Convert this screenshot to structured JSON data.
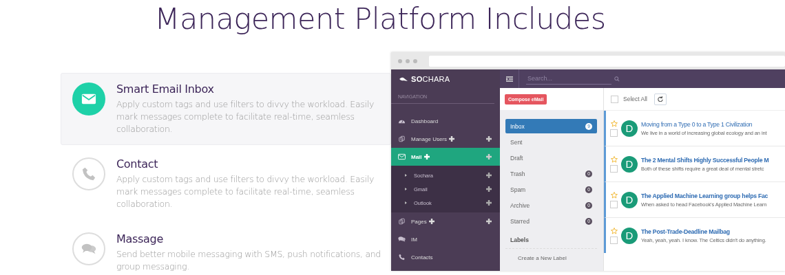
{
  "heading": "Management Platform Includes",
  "features": [
    {
      "kind": "mail",
      "title": "Smart Email Inbox",
      "description": "Apply custom tags and use filters to divvy the workload. Easily mark messages complete to facilitate real-time, seamless collaboration.",
      "selected": true
    },
    {
      "kind": "phone",
      "title": "Contact",
      "description": "Apply custom tags and use filters to divvy the workload. Easily mark messages complete to facilitate real-time, seamless collaboration.",
      "selected": false
    },
    {
      "kind": "chat",
      "title": "Massage",
      "description": "Send better mobile messaging with SMS, push notifications, and group messaging.",
      "selected": false
    }
  ],
  "app": {
    "logo": "**SO**CHARA",
    "navigation_label": "NAVIGATION",
    "nav_items": [
      {
        "kind": "dashboard",
        "label": "Dashboard",
        "has_add": false,
        "selected": false
      },
      {
        "kind": "users",
        "label": "Manage Users",
        "has_add": true,
        "selected": false
      },
      {
        "kind": "mail",
        "label": "Mail",
        "has_add": true,
        "selected": true,
        "children": [
          {
            "label": "Sochara"
          },
          {
            "label": "Gmail"
          },
          {
            "label": "Outlook"
          }
        ]
      },
      {
        "kind": "users",
        "label": "Pages",
        "has_add": true,
        "selected": false
      },
      {
        "kind": "chat",
        "label": "IM",
        "has_add": false,
        "selected": false
      },
      {
        "kind": "phone",
        "label": "Contacts",
        "has_add": false,
        "selected": false
      }
    ],
    "search": {
      "placeholder": "Search..."
    },
    "compose_button": "Compose eMail",
    "folders": [
      {
        "label": "Inbox",
        "count": "9",
        "selected": true
      },
      {
        "label": "Sent",
        "selected": false
      },
      {
        "label": "Draft",
        "selected": false
      },
      {
        "label": "Trash",
        "count": "0",
        "selected": false
      },
      {
        "label": "Spam",
        "count": "0",
        "selected": false
      },
      {
        "label": "Archive",
        "count": "0",
        "selected": false
      },
      {
        "label": "Starred",
        "count": "0",
        "selected": false
      }
    ],
    "labels_heading": "Labels",
    "create_label": "Create a New Label",
    "select_all": {
      "label": "Select All",
      "checked": false
    },
    "emails": [
      {
        "avatar": "D",
        "subject": "Moving from a Type 0 to a Type 1 Civilization",
        "snippet": "We live in a world of increasing global ecology and an int",
        "starred": false,
        "checked": false,
        "read": true
      },
      {
        "avatar": "D",
        "subject": "The 2 Mental Shifts Highly Successful People M",
        "snippet": "Both of these shifts require a great deal of mental stretc",
        "starred": false,
        "checked": false,
        "read": false
      },
      {
        "avatar": "D",
        "subject": "The Applied Machine Learning group helps Fac",
        "snippet": "When asked to head Facebook's Applied Machine Learn",
        "starred": false,
        "checked": false,
        "read": false
      },
      {
        "avatar": "D",
        "subject": "The Post-Trade-Deadline Mailbag",
        "snippet": "Yeah, yeah, yeah. I know. The Celtics didn't do anything.",
        "starred": false,
        "checked": false,
        "read": false
      }
    ]
  }
}
